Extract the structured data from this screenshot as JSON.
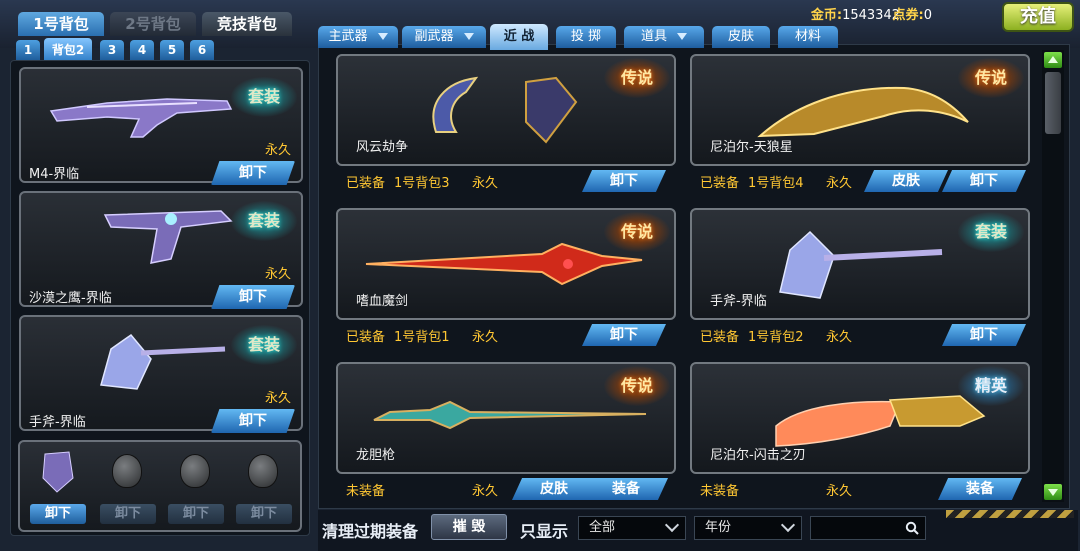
{
  "header": {
    "bag_tabs": [
      "1号背包",
      "2号背包",
      "竞技背包"
    ],
    "sub_tabs": [
      "1",
      "背包2",
      "3",
      "4",
      "5",
      "6"
    ],
    "coins_label": "金币:",
    "coins_value": "1543342",
    "points_label": "点券:",
    "points_value": "0",
    "recharge_label": "充值"
  },
  "categories": [
    "主武器",
    "副武器",
    "近 战",
    "投 掷",
    "道具",
    "皮肤",
    "材料"
  ],
  "active_category": "近 战",
  "equipped": [
    {
      "name": "M4-界临",
      "duration": "永久",
      "badge": "套装",
      "action": "卸下"
    },
    {
      "name": "沙漠之鹰-界临",
      "duration": "永久",
      "badge": "套装",
      "action": "卸下"
    },
    {
      "name": "手斧-界临",
      "duration": "永久",
      "badge": "套装",
      "action": "卸下"
    }
  ],
  "grenades": {
    "actions": [
      "卸下",
      "卸下",
      "卸下",
      "卸下"
    ]
  },
  "items": [
    {
      "name": "风云劫争",
      "badge": "传说",
      "status": "已装备",
      "bag": "1号背包3",
      "duration": "永久",
      "buttons": [
        "卸下"
      ]
    },
    {
      "name": "尼泊尔-天狼星",
      "badge": "传说",
      "status": "已装备",
      "bag": "1号背包4",
      "duration": "永久",
      "buttons": [
        "皮肤",
        "卸下"
      ]
    },
    {
      "name": "嗜血魔剑",
      "badge": "传说",
      "status": "已装备",
      "bag": "1号背包1",
      "duration": "永久",
      "buttons": [
        "卸下"
      ]
    },
    {
      "name": "手斧-界临",
      "badge": "套装",
      "status": "已装备",
      "bag": "1号背包2",
      "duration": "永久",
      "buttons": [
        "卸下"
      ]
    },
    {
      "name": "龙胆枪",
      "badge": "传说",
      "status": "未装备",
      "bag": "",
      "duration": "永久",
      "buttons": [
        "皮肤",
        "装备"
      ]
    },
    {
      "name": "尼泊尔-闪击之刃",
      "badge": "精英",
      "status": "未装备",
      "bag": "",
      "duration": "永久",
      "buttons": [
        "装备"
      ]
    }
  ],
  "footer": {
    "clear_expired_label": "清理过期装备",
    "destroy_label": "摧 毁",
    "show_only_label": "只显示",
    "filter_value": "全部",
    "year_value": "年份",
    "search_value": ""
  },
  "colors": {
    "accent_blue": "#2a7cc6",
    "gold_text": "#ffc733",
    "recharge_green": "#8cb020"
  }
}
